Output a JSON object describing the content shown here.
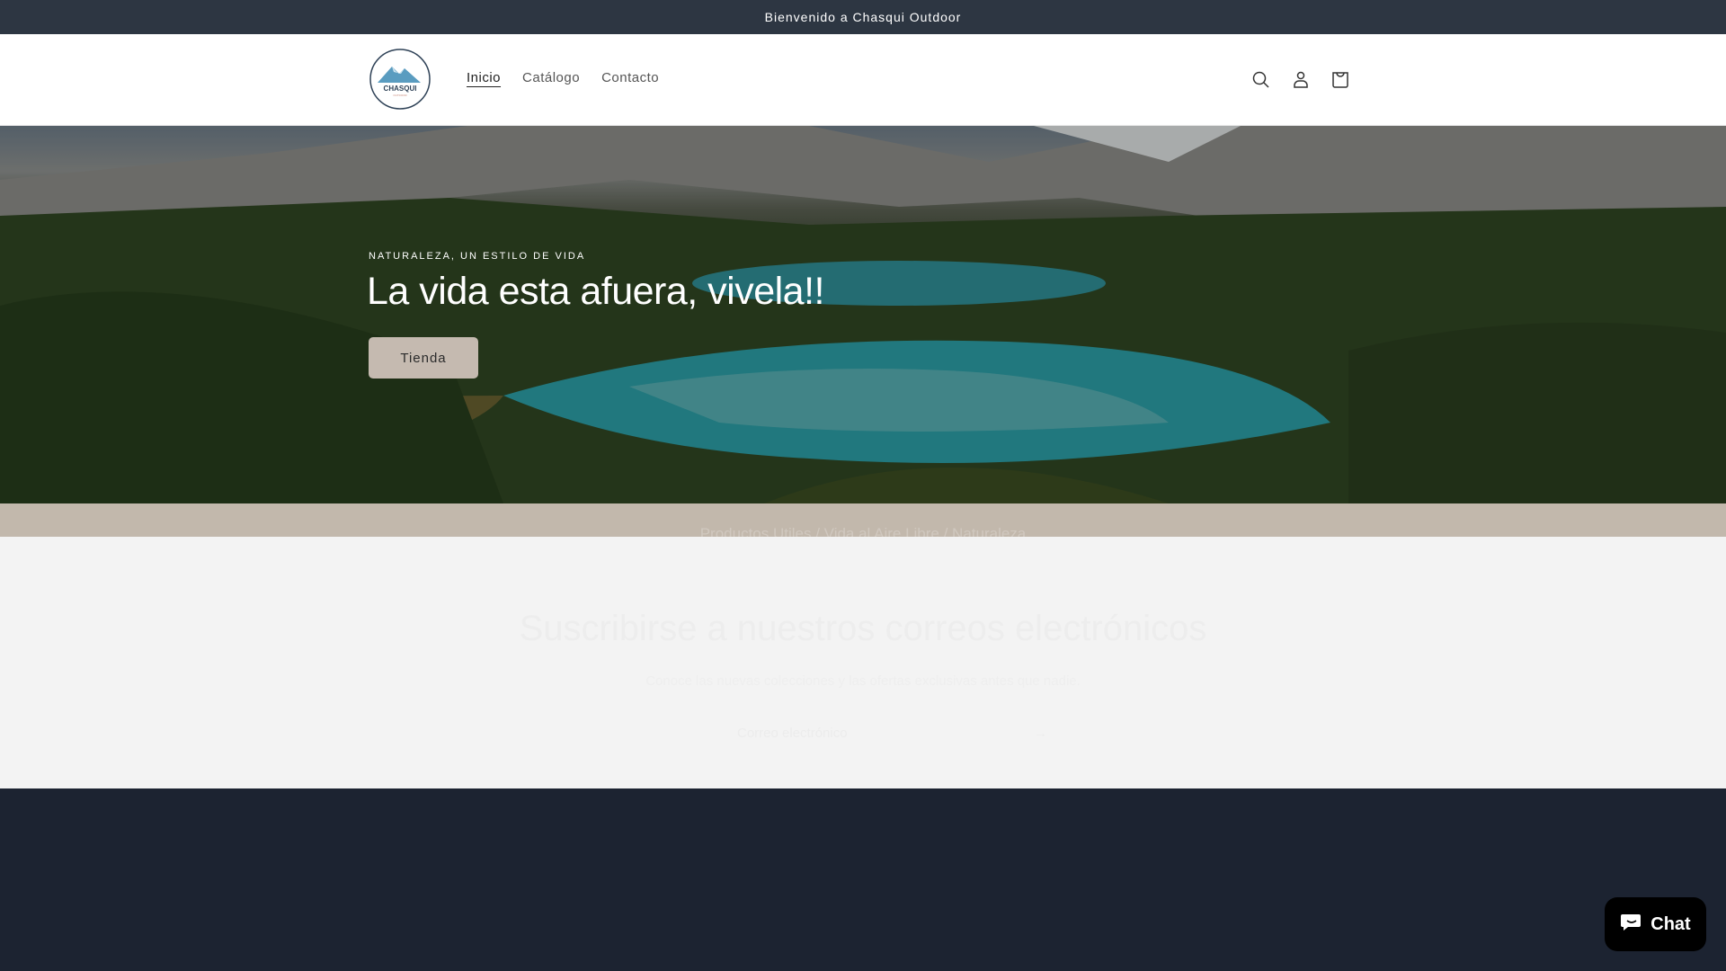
{
  "announcement": "Bienvenido a Chasqui Outdoor",
  "brand": {
    "name": "CHASQUI",
    "sub": "OUTDOOR"
  },
  "nav": [
    "Inicio",
    "Catálogo",
    "Contacto"
  ],
  "icons": [
    "search-icon",
    "account-icon",
    "cart-icon"
  ],
  "hero": {
    "kicker": "NATURALEZA, UN ESTILO DE VIDA",
    "title": "La vida esta afuera, vivela!!",
    "button": "Tienda"
  },
  "band": {
    "text": "Productos Utiles / Vida al Aire Libre / Naturaleza"
  },
  "newsletter": {
    "title": "Suscribirse a nuestros correos electrónicos",
    "subtitle": "Conoce las nuevas colecciones y las ofertas exclusivas antes que nadie.",
    "placeholder": "Correo electrónico",
    "submit": "→"
  },
  "chat": {
    "label": "Chat"
  },
  "colors": {
    "announce": "#2d3642",
    "band": "#c2b8ac",
    "footer": "#1c2331",
    "button": "#c5bab0"
  }
}
